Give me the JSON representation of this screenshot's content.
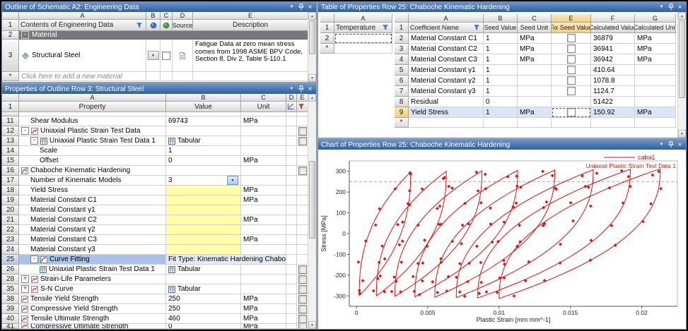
{
  "panels": {
    "outline": {
      "title": "Outline of Schematic A2: Engineering Data",
      "columns": [
        "A",
        "B",
        "C",
        "D",
        "E"
      ],
      "header_row_num": "1",
      "contents_label": "Contents of Engineering Data",
      "source_label": "Source",
      "description_label": "Description",
      "material_row_num": "2",
      "material_band": "Material",
      "steel_row_num": "3",
      "steel_name": "Structural Steel",
      "steel_description": "Fatigue Data at zero mean stress comes from 1998 ASME BPV Code, Section 8, Div 2, Table 5-110.1",
      "add_row_num": "*",
      "add_label": "Click here to add a new material"
    },
    "properties": {
      "title": "Properties of Outline Row 3: Structural Steel",
      "columns": [
        "A",
        "B",
        "C",
        "D",
        "E"
      ],
      "header_row_num": "1",
      "headers": {
        "property": "Property",
        "value": "Value",
        "unit": "Unit"
      },
      "rows": [
        {
          "num": "",
          "indent": 1,
          "exp": "",
          "icon": "",
          "label": "",
          "value": "",
          "vtype": "plain",
          "unit": "",
          "check": false,
          "selected": false,
          "partial": true
        },
        {
          "num": "11",
          "indent": 2,
          "exp": "",
          "icon": "",
          "label": "Shear Modulus",
          "value": "69743",
          "vtype": "plain",
          "unit": "MPa",
          "check": false,
          "selected": false,
          "partial": false
        },
        {
          "num": "12",
          "indent": 1,
          "exp": "-",
          "icon": "chart",
          "label": "Uniaxial Plastic Strain Test Data",
          "value": "",
          "vtype": "plain",
          "unit": "",
          "check": true,
          "selected": false,
          "partial": false
        },
        {
          "num": "13",
          "indent": 2,
          "exp": "-",
          "icon": "table",
          "label": "Uniaxial Plastic Strain Test Data 1",
          "value": "Tabular",
          "vtype": "tabular",
          "unit": "",
          "check": true,
          "selected": false,
          "partial": false
        },
        {
          "num": "14",
          "indent": 3,
          "exp": "",
          "icon": "",
          "label": "Scale",
          "value": "1",
          "vtype": "plain",
          "unit": "",
          "check": false,
          "selected": false,
          "partial": false
        },
        {
          "num": "15",
          "indent": 3,
          "exp": "",
          "icon": "",
          "label": "Offset",
          "value": "0",
          "vtype": "plain",
          "unit": "MPa",
          "check": false,
          "selected": false,
          "partial": false
        },
        {
          "num": "16",
          "indent": 1,
          "exp": "",
          "icon": "chab",
          "label": "Chaboche Kinematic Hardening",
          "value": "",
          "vtype": "plain",
          "unit": "",
          "check": true,
          "selected": false,
          "partial": false
        },
        {
          "num": "17",
          "indent": 2,
          "exp": "",
          "icon": "",
          "label": "Number of Kinematic Models",
          "value": "3",
          "vtype": "dropdown",
          "unit": "",
          "check": false,
          "selected": false,
          "partial": false
        },
        {
          "num": "18",
          "indent": 2,
          "exp": "",
          "icon": "",
          "label": "Yield Stress",
          "value": "",
          "vtype": "yellow",
          "unit": "MPa",
          "check": false,
          "selected": false,
          "partial": false
        },
        {
          "num": "19",
          "indent": 2,
          "exp": "",
          "icon": "",
          "label": "Material Constant C1",
          "value": "",
          "vtype": "yellow",
          "unit": "MPa",
          "check": false,
          "selected": false,
          "partial": false
        },
        {
          "num": "20",
          "indent": 2,
          "exp": "",
          "icon": "",
          "label": "Material Constant γ1",
          "value": "",
          "vtype": "yellow",
          "unit": "",
          "check": false,
          "selected": false,
          "partial": false
        },
        {
          "num": "21",
          "indent": 2,
          "exp": "",
          "icon": "",
          "label": "Material Constant C2",
          "value": "",
          "vtype": "yellow",
          "unit": "MPa",
          "check": false,
          "selected": false,
          "partial": false
        },
        {
          "num": "22",
          "indent": 2,
          "exp": "",
          "icon": "",
          "label": "Material Constant γ2",
          "value": "",
          "vtype": "yellow",
          "unit": "",
          "check": false,
          "selected": false,
          "partial": false
        },
        {
          "num": "23",
          "indent": 2,
          "exp": "",
          "icon": "",
          "label": "Material Constant C3",
          "value": "",
          "vtype": "yellow",
          "unit": "MPa",
          "check": false,
          "selected": false,
          "partial": false
        },
        {
          "num": "24",
          "indent": 2,
          "exp": "",
          "icon": "",
          "label": "Material Constant γ3",
          "value": "",
          "vtype": "yellow",
          "unit": "",
          "check": false,
          "selected": false,
          "partial": false
        },
        {
          "num": "25",
          "indent": 2,
          "exp": "-",
          "icon": "curve",
          "label": "Curve Fitting",
          "value": "Fit Type: Kinematic Hardening Chaboche",
          "vtype": "fittype",
          "unit": "",
          "check": false,
          "selected": true,
          "partial": false
        },
        {
          "num": "26",
          "indent": 3,
          "exp": "",
          "icon": "table",
          "label": "Uniaxial Plastic Strain Test Data 1",
          "value": "Tabular",
          "vtype": "tabular",
          "unit": "",
          "check": true,
          "selected": false,
          "partial": false
        },
        {
          "num": "28",
          "indent": 1,
          "exp": "+",
          "icon": "chart",
          "label": "Strain-Life Parameters",
          "value": "",
          "vtype": "plain",
          "unit": "",
          "check": true,
          "selected": false,
          "partial": false
        },
        {
          "num": "35",
          "indent": 1,
          "exp": "+",
          "icon": "chart",
          "label": "S-N Curve",
          "value": "Tabular",
          "vtype": "tabular",
          "unit": "",
          "check": true,
          "selected": false,
          "partial": false
        },
        {
          "num": "38",
          "indent": 1,
          "exp": "",
          "icon": "chart",
          "label": "Tensile Yield Strength",
          "value": "250",
          "vtype": "plain",
          "unit": "MPa",
          "check": true,
          "selected": false,
          "partial": false
        },
        {
          "num": "39",
          "indent": 1,
          "exp": "",
          "icon": "chart",
          "label": "Compressive Yield Strength",
          "value": "250",
          "vtype": "plain",
          "unit": "MPa",
          "check": true,
          "selected": false,
          "partial": false
        },
        {
          "num": "40",
          "indent": 1,
          "exp": "",
          "icon": "chart",
          "label": "Tensile Ultimate Strength",
          "value": "460",
          "vtype": "plain",
          "unit": "MPa",
          "check": true,
          "selected": false,
          "partial": false
        },
        {
          "num": "41",
          "indent": 1,
          "exp": "",
          "icon": "chart",
          "label": "Compressive Ultimate Strength",
          "value": "0",
          "vtype": "plain",
          "unit": "MPa",
          "check": true,
          "selected": false,
          "partial": true
        }
      ]
    },
    "coef_table": {
      "title": "Table of Properties Row 25: Chaboche Kinematic Hardening",
      "temp_table": {
        "column": "A",
        "header_row_num": "1",
        "header": "Temperature",
        "rows": [
          {
            "num": "2",
            "value": "",
            "active": true
          },
          {
            "num": "*",
            "value": "",
            "active": false
          }
        ]
      },
      "main_table": {
        "columns": [
          "A",
          "B",
          "C",
          "E",
          "F",
          "G"
        ],
        "highlight_column": "E",
        "header_row_num": "1",
        "headers": [
          "Coefficient Name",
          "Seed Value",
          "Seed Unit",
          "Fix Seed Value",
          "Calculated Value",
          "Calculated Unit"
        ],
        "rows": [
          {
            "num": "2",
            "name": "Material Constant C1",
            "seed": "1",
            "seed_unit": "MPa",
            "fix_checkbox": true,
            "calc": "36879",
            "calc_unit": "MPa",
            "selected": false
          },
          {
            "num": "3",
            "name": "Material Constant C2",
            "seed": "1",
            "seed_unit": "MPa",
            "fix_checkbox": true,
            "calc": "36941",
            "calc_unit": "MPa",
            "selected": false
          },
          {
            "num": "4",
            "name": "Material Constant C3",
            "seed": "1",
            "seed_unit": "MPa",
            "fix_checkbox": true,
            "calc": "36942",
            "calc_unit": "MPa",
            "selected": false
          },
          {
            "num": "5",
            "name": "Material Constant γ1",
            "seed": "1",
            "seed_unit": "",
            "fix_checkbox": true,
            "calc": "410.64",
            "calc_unit": "",
            "selected": false
          },
          {
            "num": "6",
            "name": "Material Constant γ2",
            "seed": "1",
            "seed_unit": "",
            "fix_checkbox": true,
            "calc": "1078.8",
            "calc_unit": "",
            "selected": false
          },
          {
            "num": "7",
            "name": "Material Constant γ3",
            "seed": "1",
            "seed_unit": "",
            "fix_checkbox": true,
            "calc": "1124.7",
            "calc_unit": "",
            "selected": false
          },
          {
            "num": "8",
            "name": "Residual",
            "seed": "0",
            "seed_unit": "",
            "fix_checkbox": false,
            "calc": "51422",
            "calc_unit": "",
            "selected": false
          },
          {
            "num": "9",
            "name": "Yield Stress",
            "seed": "1",
            "seed_unit": "MPa",
            "fix_checkbox": true,
            "calc": "150.92",
            "calc_unit": "MPa",
            "selected": true
          }
        ],
        "star_row_num": "*"
      }
    },
    "chart": {
      "title": "Chart of Properties Row 25: Chaboche Kinematic Hardening"
    }
  },
  "chart_data": {
    "type": "line",
    "title": "",
    "xlabel": "Plastic Strain  [mm mm^-1]",
    "ylabel": "Stress  [MPa]",
    "xlim": [
      -0.0005,
      0.0225
    ],
    "ylim": [
      -350,
      350
    ],
    "x_ticks": [
      0,
      0.005,
      0.01,
      0.015,
      0.02
    ],
    "y_ticks": [
      300,
      200,
      100,
      0,
      -100,
      -200,
      -300
    ],
    "grid": false,
    "reference_line_y": 250,
    "color": "#dd1111",
    "legend": [
      "caba1",
      "Uniaxial Plastic Strain Test Data 1"
    ],
    "legend_position": "top-right",
    "curve_exponent": 2.4,
    "hysteresis_loops": [
      {
        "x_start": 0.0002,
        "x_end": 0.0038,
        "stress_amplitude": 298
      },
      {
        "x_start": 0.0014,
        "x_end": 0.0063,
        "stress_amplitude": 300
      },
      {
        "x_start": 0.0027,
        "x_end": 0.0088,
        "stress_amplitude": 302
      },
      {
        "x_start": 0.0041,
        "x_end": 0.0113,
        "stress_amplitude": 304
      },
      {
        "x_start": 0.0055,
        "x_end": 0.0139,
        "stress_amplitude": 306
      },
      {
        "x_start": 0.007,
        "x_end": 0.0166,
        "stress_amplitude": 308
      },
      {
        "x_start": 0.0085,
        "x_end": 0.0192,
        "stress_amplitude": 310
      },
      {
        "x_start": 0.01,
        "x_end": 0.0213,
        "stress_amplitude": 312
      }
    ]
  }
}
